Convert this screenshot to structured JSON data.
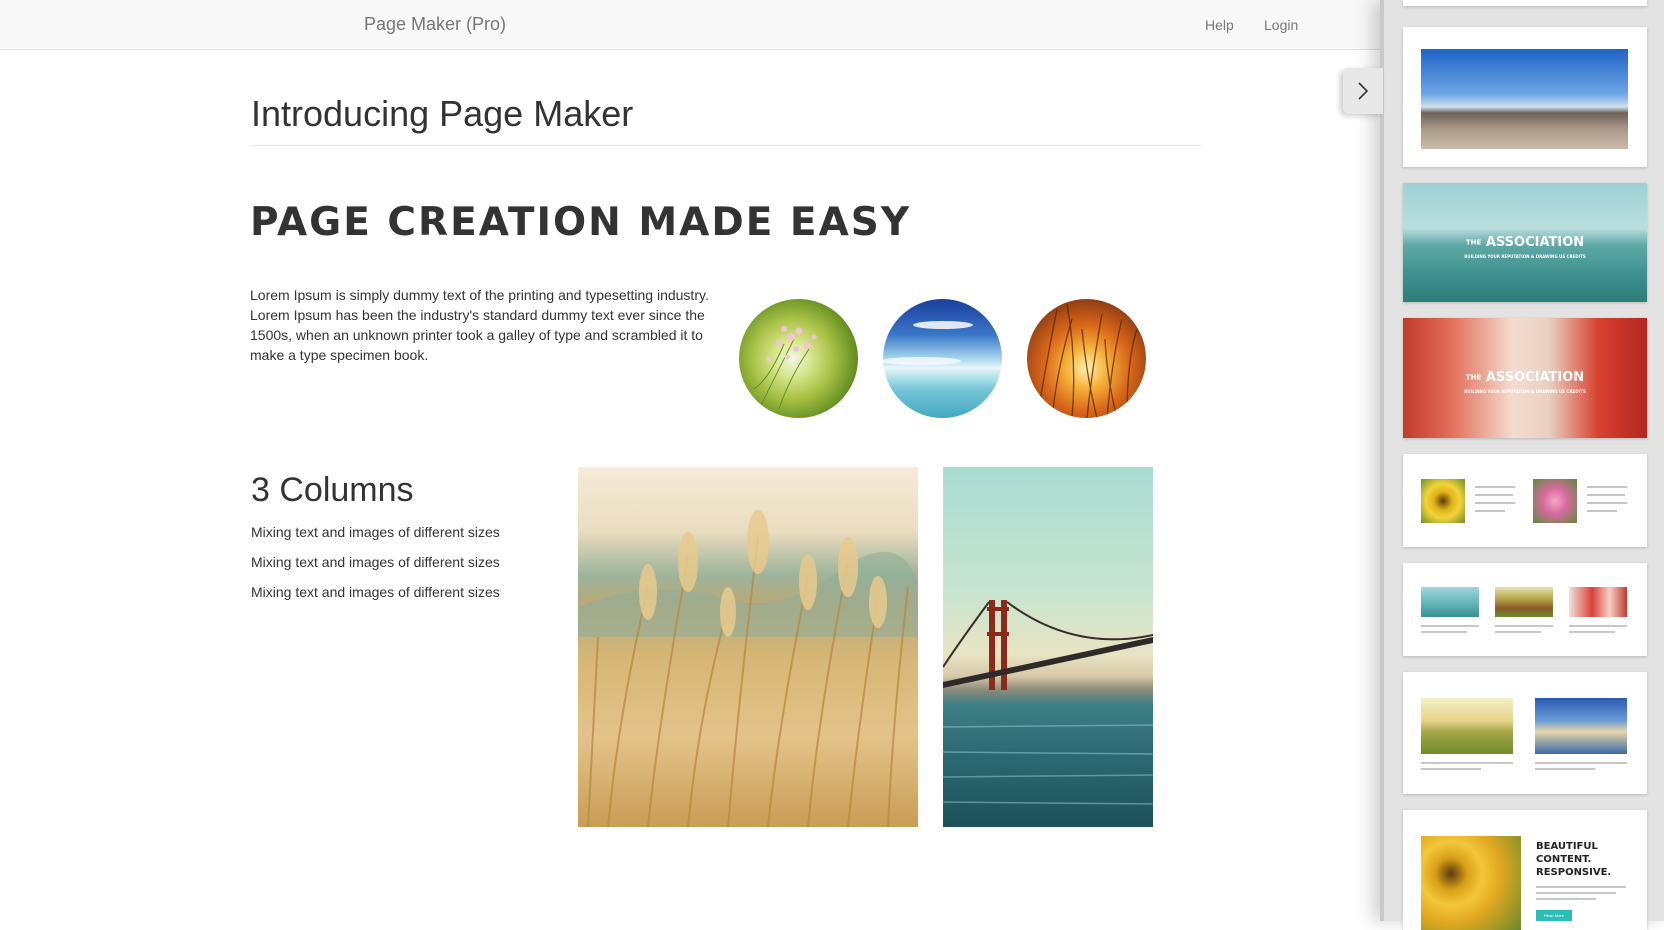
{
  "navbar": {
    "brand": "Page Maker (Pro)",
    "links": {
      "help": "Help",
      "login": "Login"
    }
  },
  "main": {
    "title": "Introducing Page Maker",
    "hero_heading": "PAGE CREATION MADE EASY",
    "intro_text": "Lorem Ipsum is simply dummy text of the printing and typesetting industry. Lorem Ipsum has been the industry's standard dummy text ever since the 1500s, when an unknown printer took a galley of type and scrambled it to make a type specimen book.",
    "columns": {
      "heading": "3 Columns",
      "lines": [
        "Mixing text and images of different sizes",
        "Mixing text and images of different sizes",
        "Mixing text and images of different sizes"
      ]
    }
  },
  "panel": {
    "toggle_icon": "chevron-right-icon",
    "thumbs": {
      "t2": {
        "prefix": "THE",
        "title": "ASSOCIATION",
        "subtitle": "BUILDING YOUR REPUTATION & DRAWING US CREDITS"
      },
      "t3": {
        "prefix": "THE",
        "title": "ASSOCIATION",
        "subtitle": "BUILDING YOUR REPUTATION & DRAWING US CREDITS"
      },
      "t7": {
        "headline_1": "BEAUTIFUL",
        "headline_2": "CONTENT.",
        "headline_3": "RESPONSIVE.",
        "button": "Read More"
      }
    }
  },
  "colors": {
    "navbar_bg": "#f8f8f8",
    "text": "#333333",
    "muted": "#777777",
    "panel_bg": "#e3e3e3",
    "accent_teal": "#2dbdb6"
  }
}
